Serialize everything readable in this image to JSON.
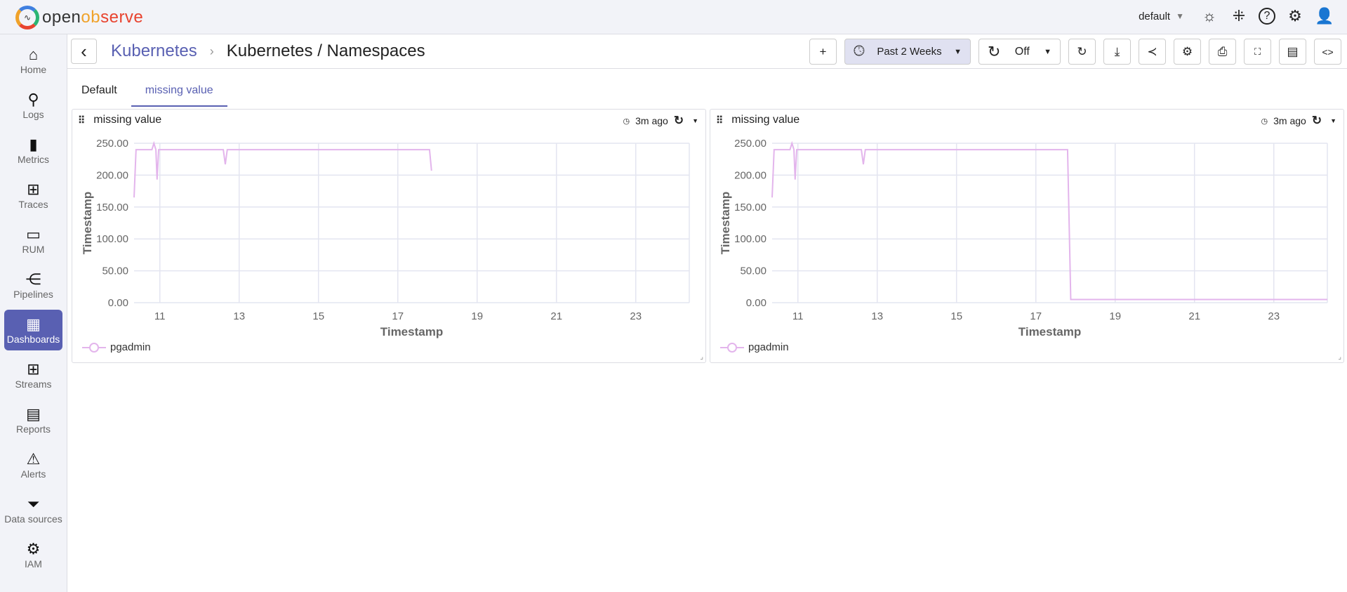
{
  "app": {
    "logo_text_a": "open",
    "logo_text_b": "ob",
    "logo_text_c": "serve",
    "org": "default"
  },
  "header_icons": [
    "sun-icon",
    "slack-icon",
    "help-icon",
    "settings-icon",
    "user-icon"
  ],
  "sidebar": {
    "items": [
      {
        "label": "Home",
        "icon": "⌂",
        "name": "home"
      },
      {
        "label": "Logs",
        "icon": "⚲",
        "name": "logs"
      },
      {
        "label": "Metrics",
        "icon": "▮",
        "name": "metrics"
      },
      {
        "label": "Traces",
        "icon": "⊞",
        "name": "traces"
      },
      {
        "label": "RUM",
        "icon": "▭",
        "name": "rum"
      },
      {
        "label": "Pipelines",
        "icon": "⋲",
        "name": "pipelines"
      },
      {
        "label": "Dashboards",
        "icon": "▦",
        "name": "dashboards",
        "active": true
      },
      {
        "label": "Streams",
        "icon": "⊞",
        "name": "streams"
      },
      {
        "label": "Reports",
        "icon": "▤",
        "name": "reports"
      },
      {
        "label": "Alerts",
        "icon": "⚠",
        "name": "alerts"
      },
      {
        "label": "Data sources",
        "icon": "⏷",
        "name": "data-sources"
      },
      {
        "label": "IAM",
        "icon": "⚙",
        "name": "iam"
      }
    ]
  },
  "breadcrumb": {
    "parent": "Kubernetes",
    "current": "Kubernetes / Namespaces"
  },
  "toolbar": {
    "add": "+",
    "time_range": "Past 2 Weeks",
    "refresh_interval": "Off"
  },
  "tabs": [
    {
      "label": "Default"
    },
    {
      "label": "missing value",
      "active": true
    }
  ],
  "panels": [
    {
      "title": "missing value",
      "updated": "3m ago",
      "legend": "pgadmin"
    },
    {
      "title": "missing value",
      "updated": "3m ago",
      "legend": "pgadmin"
    }
  ],
  "colors": {
    "accent": "#5960b2",
    "series": "#e3b5ec"
  },
  "chart_data": [
    {
      "type": "line",
      "xlabel": "Timestamp",
      "ylabel": "Timestamp",
      "xlim": [
        10.35,
        24.35
      ],
      "ylim": [
        0,
        250
      ],
      "xticks": [
        11,
        13,
        15,
        17,
        19,
        21,
        23
      ],
      "yticks": [
        "0.00",
        "50.00",
        "100.00",
        "150.00",
        "200.00",
        "250.00"
      ],
      "grid": true,
      "legend_position": "bottom-left",
      "series": [
        {
          "name": "pgadmin",
          "points": [
            [
              10.35,
              165
            ],
            [
              10.4,
              240
            ],
            [
              10.8,
              240
            ],
            [
              10.85,
              250
            ],
            [
              10.9,
              240
            ],
            [
              10.93,
              193
            ],
            [
              10.97,
              240
            ],
            [
              12.6,
              240
            ],
            [
              12.65,
              217
            ],
            [
              12.7,
              240
            ],
            [
              17.8,
              240
            ],
            [
              17.85,
              207
            ]
          ]
        }
      ]
    },
    {
      "type": "line",
      "xlabel": "Timestamp",
      "ylabel": "Timestamp",
      "xlim": [
        10.35,
        24.35
      ],
      "ylim": [
        0,
        250
      ],
      "xticks": [
        11,
        13,
        15,
        17,
        19,
        21,
        23
      ],
      "yticks": [
        "0.00",
        "50.00",
        "100.00",
        "150.00",
        "200.00",
        "250.00"
      ],
      "grid": true,
      "legend_position": "bottom-left",
      "series": [
        {
          "name": "pgadmin",
          "points": [
            [
              10.35,
              165
            ],
            [
              10.4,
              240
            ],
            [
              10.8,
              240
            ],
            [
              10.85,
              250
            ],
            [
              10.9,
              240
            ],
            [
              10.93,
              193
            ],
            [
              10.97,
              240
            ],
            [
              12.6,
              240
            ],
            [
              12.65,
              217
            ],
            [
              12.7,
              240
            ],
            [
              17.8,
              240
            ],
            [
              17.88,
              5
            ],
            [
              24.35,
              5
            ]
          ]
        }
      ]
    }
  ]
}
